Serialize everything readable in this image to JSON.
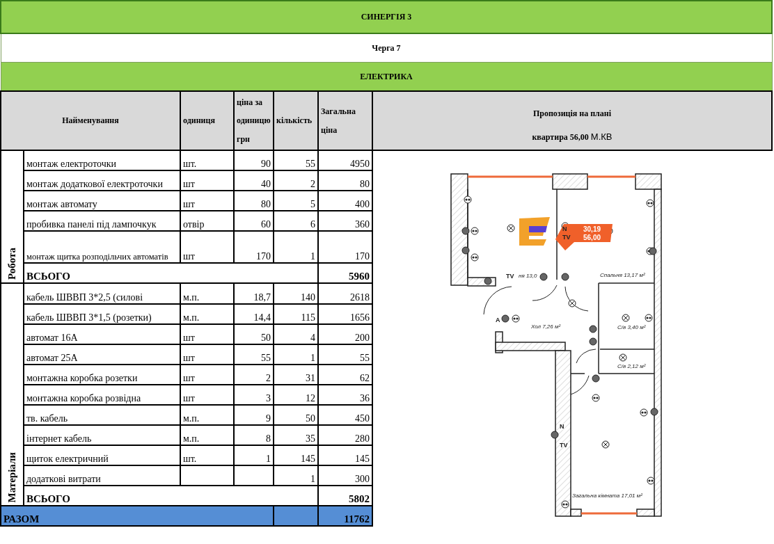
{
  "title": "СИНЕРГІЯ 3",
  "queue": "Черга 7",
  "section": "ЕЛЕКТРИКА",
  "columns": [
    "Найменування",
    "одиниця",
    "ціна за одиницю грн",
    "кількість",
    "Загальна ціна"
  ],
  "proposal": {
    "heading": "Пропозиція на плані",
    "subheading": "квартира 56,00",
    "unit": "М.КВ"
  },
  "groups": [
    {
      "label": "Робота",
      "total_label": "ВСЬОГО",
      "total": "5960",
      "rows": [
        {
          "name": "монтаж електроточки",
          "unit": "шт.",
          "price": "90",
          "qty": "55",
          "total": "4950"
        },
        {
          "name": "монтаж додаткової електроточки",
          "unit": "шт",
          "price": "40",
          "qty": "2",
          "total": "80"
        },
        {
          "name": "монтаж автомату",
          "unit": "шт",
          "price": "80",
          "qty": "5",
          "total": "400"
        },
        {
          "name": "пробивка панелі під лампочкук",
          "unit": "отвір",
          "price": "60",
          "qty": "6",
          "total": "360"
        },
        {
          "name": "монтаж щитка розподільчих автоматів",
          "unit": "шт",
          "price": "170",
          "qty": "1",
          "total": "170",
          "kind": "tall"
        }
      ]
    },
    {
      "label": "Матеріали",
      "total_label": "ВСЬОГО",
      "total": "5802",
      "rows": [
        {
          "name": "кабель ШВВП 3*2,5  (силові",
          "unit": "м.п.",
          "price": "18,7",
          "qty": "140",
          "total": "2618"
        },
        {
          "name": "кабель ШВВП 3*1,5 (розетки)",
          "unit": "м.п.",
          "price": "14,4",
          "qty": "115",
          "total": "1656"
        },
        {
          "name": "автомат 16А",
          "unit": "шт",
          "price": "50",
          "qty": "4",
          "total": "200"
        },
        {
          "name": "автомат 25А",
          "unit": "шт",
          "price": "55",
          "qty": "1",
          "total": "55"
        },
        {
          "name": "монтажна коробка розетки",
          "unit": "шт",
          "price": "2",
          "qty": "31",
          "total": "62"
        },
        {
          "name": "монтажна коробка розвідна",
          "unit": "шт",
          "price": "3",
          "qty": "12",
          "total": "36"
        },
        {
          "name": "тв. кабель",
          "unit": "м.п.",
          "price": "9",
          "qty": "50",
          "total": "450"
        },
        {
          "name": "інтернет кабель",
          "unit": "м.п.",
          "price": "8",
          "qty": "35",
          "total": "280"
        },
        {
          "name": "щиток електричний",
          "unit": "шт.",
          "price": "1",
          "qty": "145",
          "total": "145"
        },
        {
          "name": "додаткові витрати",
          "unit": "",
          "price": "",
          "qty": "1",
          "total": "300"
        }
      ]
    }
  ],
  "grand_total": {
    "label": "РАЗОМ",
    "value": "11762"
  },
  "plan": {
    "labels": [
      "N",
      "TV",
      "TV",
      "ня 13,0",
      "Спальня 13,17 м²",
      "A",
      "Хол 7,26 м²",
      "С/в 3,40 м²",
      "С/в 2,12 м²",
      "N",
      "TV",
      "Загальна кімната 17,01 м²"
    ],
    "badge": [
      "30,19",
      "56,00"
    ]
  }
}
